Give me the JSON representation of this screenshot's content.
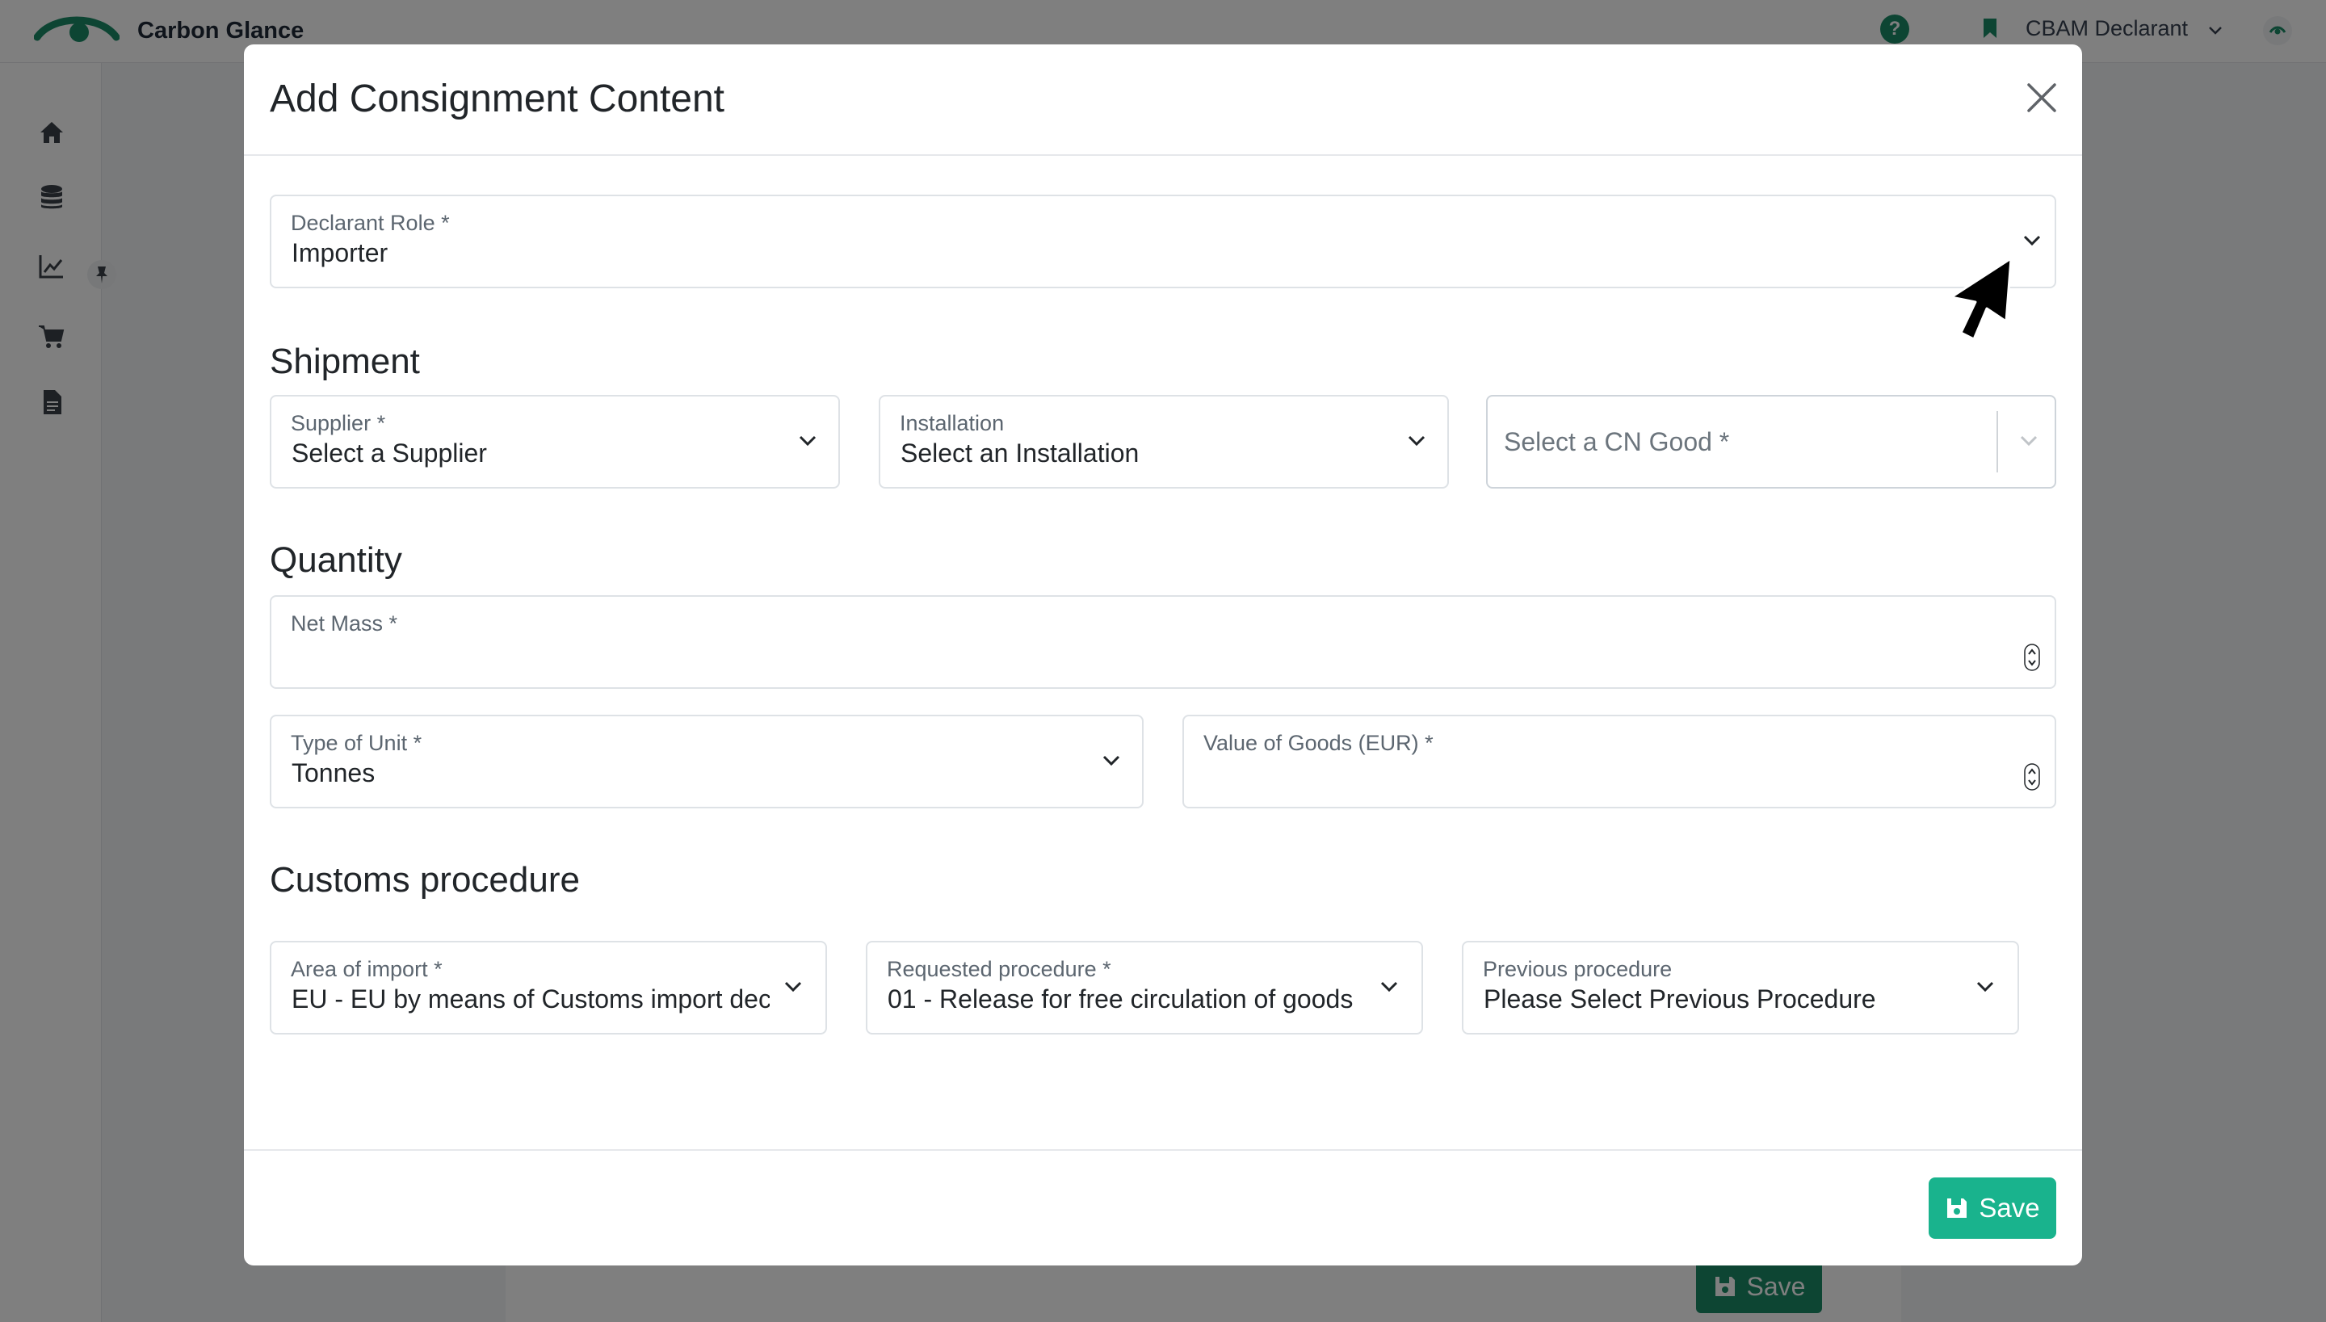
{
  "app": {
    "name": "Carbon Glance",
    "user_role": "CBAM Declarant",
    "help_symbol": "?"
  },
  "background": {
    "save_label": "Save"
  },
  "modal": {
    "title": "Add Consignment Content",
    "declarant_role": {
      "label": "Declarant Role *",
      "value": "Importer"
    },
    "sections": {
      "shipment": "Shipment",
      "quantity": "Quantity",
      "customs": "Customs procedure"
    },
    "supplier": {
      "label": "Supplier *",
      "value": "Select a Supplier"
    },
    "installation": {
      "label": "Installation",
      "value": "Select an Installation"
    },
    "cn_good": {
      "placeholder": "Select a CN Good *"
    },
    "net_mass": {
      "label": "Net Mass *",
      "value": ""
    },
    "unit_type": {
      "label": "Type of Unit *",
      "value": "Tonnes"
    },
    "goods_value": {
      "label": "Value of Goods (EUR) *",
      "value": ""
    },
    "area_of_import": {
      "label": "Area of import *",
      "value": "EU - EU by means of Customs import declaration"
    },
    "requested_procedure": {
      "label": "Requested procedure *",
      "value": "01 - Release for free circulation of goods"
    },
    "previous_procedure": {
      "label": "Previous procedure",
      "value": "Please Select Previous Procedure"
    },
    "save_label": "Save"
  },
  "colors": {
    "brand_green": "#1a8a66",
    "save_green": "#19b38d"
  }
}
